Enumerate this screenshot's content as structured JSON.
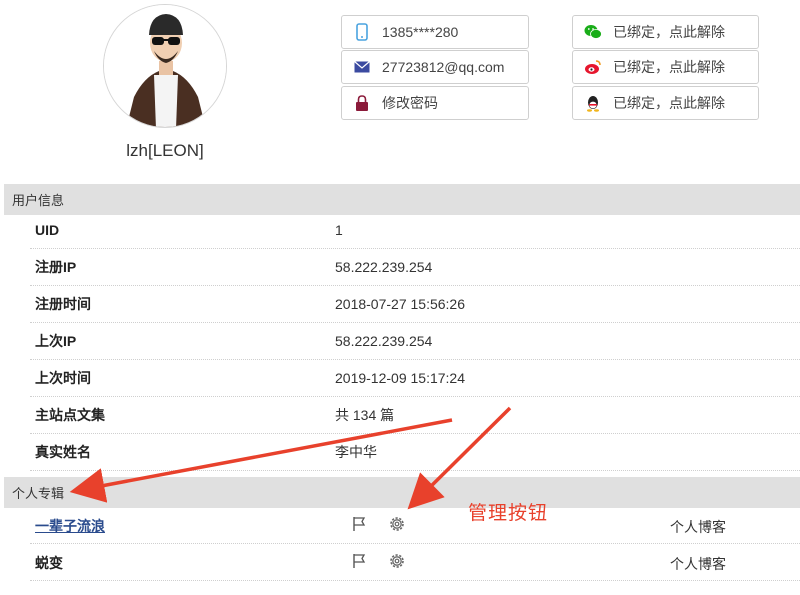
{
  "profile": {
    "username": "lzh[LEON]"
  },
  "account_bindings": {
    "phone": {
      "value": "1385****280",
      "icon": "phone-icon",
      "color": "#4aa3df"
    },
    "email": {
      "value": "27723812@qq.com",
      "icon": "envelope-icon",
      "color": "#3b4aa0"
    },
    "password": {
      "value": "修改密码",
      "icon": "lock-icon",
      "color": "#8b1a3a"
    },
    "wechat": {
      "value": "已绑定，点此解除",
      "icon": "wechat-icon",
      "color": "#1aad19"
    },
    "weibo": {
      "value": "已绑定，点此解除",
      "icon": "weibo-icon",
      "color": "#e6162d"
    },
    "qq": {
      "value": "已绑定，点此解除",
      "icon": "qq-icon",
      "color": "#222222"
    }
  },
  "user_info": {
    "title": "用户信息",
    "rows": [
      {
        "key": "UID",
        "value": "1"
      },
      {
        "key": "注册IP",
        "value": "58.222.239.254"
      },
      {
        "key": "注册时间",
        "value": "2018-07-27 15:56:26"
      },
      {
        "key": "上次IP",
        "value": "58.222.239.254"
      },
      {
        "key": "上次时间",
        "value": "2019-12-09 15:17:24"
      },
      {
        "key": "主站点文集",
        "value": "共 134 篇"
      },
      {
        "key": "真实姓名",
        "value": "李中华"
      }
    ]
  },
  "columns": {
    "title": "个人专辑",
    "rows": [
      {
        "name": "一辈子流浪",
        "type": "个人博客",
        "link": true
      },
      {
        "name": "蜕变",
        "type": "个人博客",
        "link": false
      }
    ]
  },
  "annotation": {
    "text": "管理按钮",
    "color": "#e8412c"
  }
}
